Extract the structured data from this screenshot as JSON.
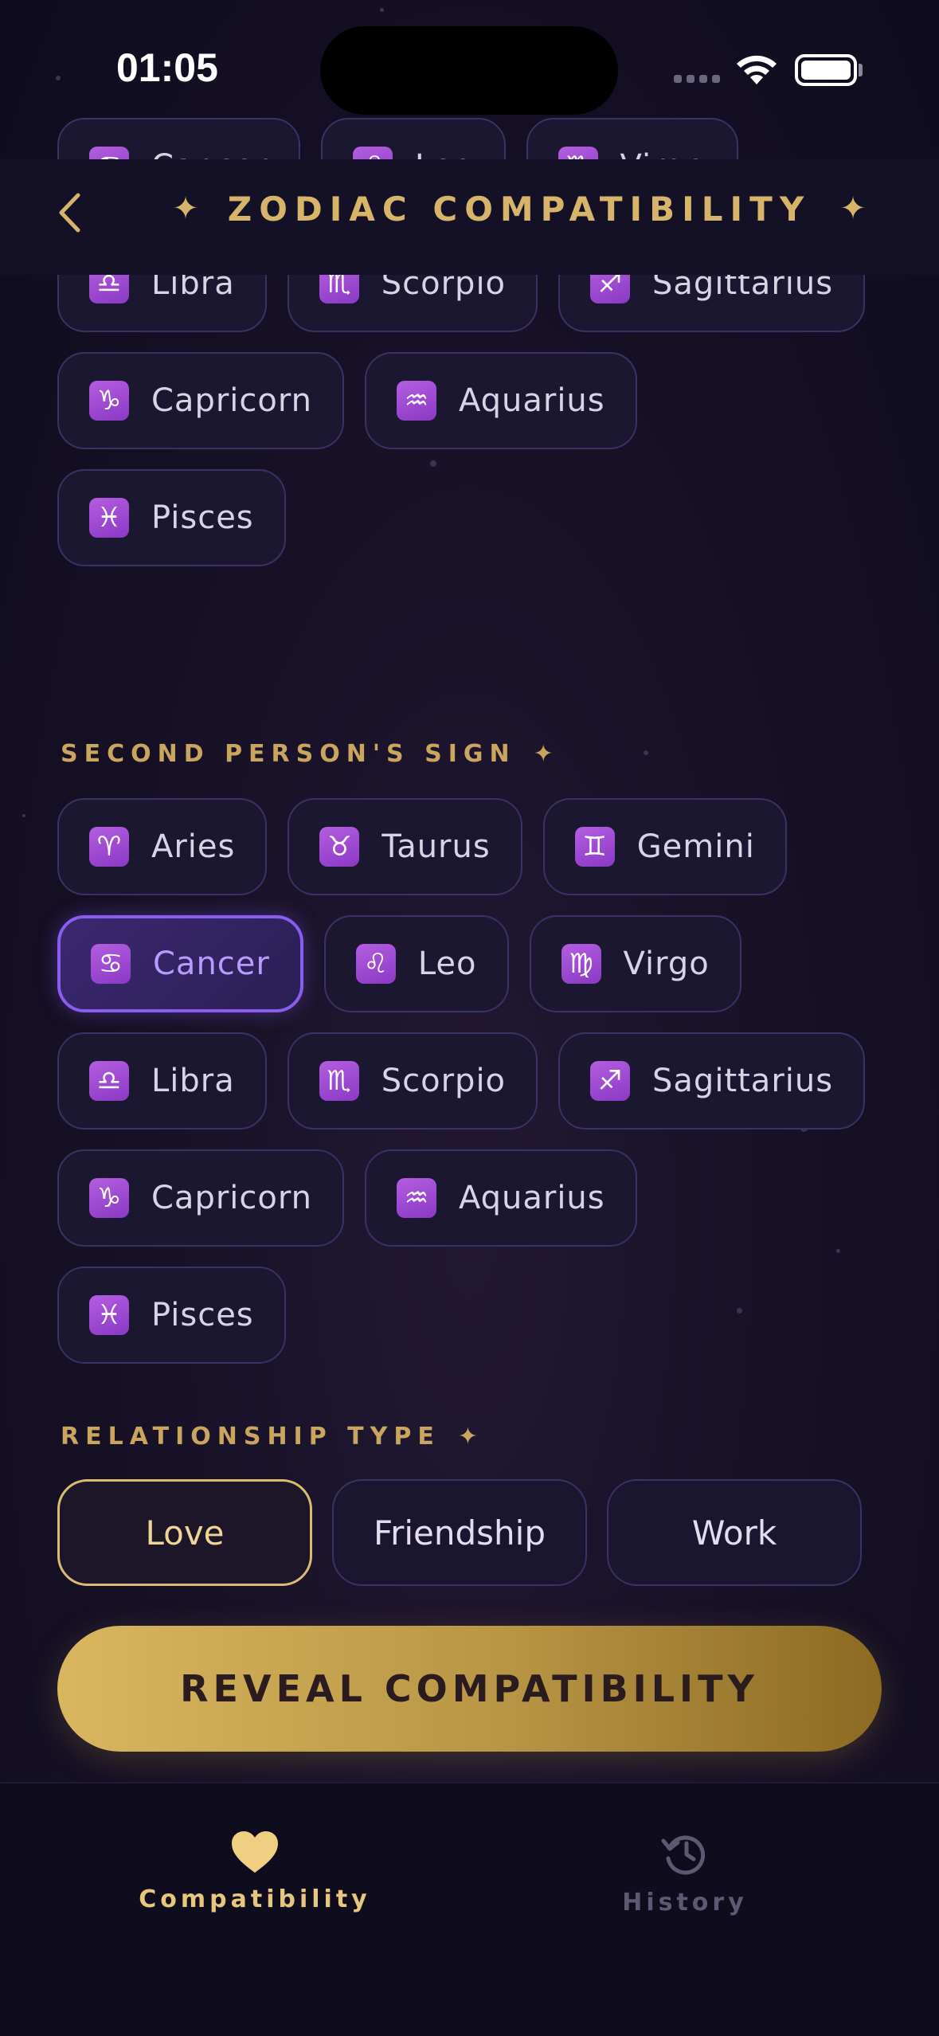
{
  "status_bar": {
    "time": "01:05"
  },
  "header": {
    "title": "ZODIAC COMPATIBILITY",
    "sparkle": "✦"
  },
  "first_sign_chips": [
    {
      "glyph": "♋",
      "label": "Cancer"
    },
    {
      "glyph": "♌",
      "label": "Leo"
    },
    {
      "glyph": "♍",
      "label": "Virgo"
    },
    {
      "glyph": "♎",
      "label": "Libra"
    },
    {
      "glyph": "♏",
      "label": "Scorpio"
    },
    {
      "glyph": "♐",
      "label": "Sagittarius"
    },
    {
      "glyph": "♑",
      "label": "Capricorn"
    },
    {
      "glyph": "♒",
      "label": "Aquarius"
    },
    {
      "glyph": "♓",
      "label": "Pisces"
    }
  ],
  "second_sign": {
    "label": "SECOND PERSON'S SIGN",
    "selected": "Cancer",
    "chips": [
      {
        "glyph": "♈",
        "label": "Aries"
      },
      {
        "glyph": "♉",
        "label": "Taurus"
      },
      {
        "glyph": "♊",
        "label": "Gemini"
      },
      {
        "glyph": "♋",
        "label": "Cancer"
      },
      {
        "glyph": "♌",
        "label": "Leo"
      },
      {
        "glyph": "♍",
        "label": "Virgo"
      },
      {
        "glyph": "♎",
        "label": "Libra"
      },
      {
        "glyph": "♏",
        "label": "Scorpio"
      },
      {
        "glyph": "♐",
        "label": "Sagittarius"
      },
      {
        "glyph": "♑",
        "label": "Capricorn"
      },
      {
        "glyph": "♒",
        "label": "Aquarius"
      },
      {
        "glyph": "♓",
        "label": "Pisces"
      }
    ]
  },
  "relationship": {
    "label": "RELATIONSHIP TYPE",
    "selected": "Love",
    "options": [
      "Love",
      "Friendship",
      "Work"
    ]
  },
  "cta": {
    "label": "REVEAL COMPATIBILITY"
  },
  "tabbar": {
    "tabs": [
      {
        "label": "Compatibility",
        "icon": "heart-icon",
        "active": true
      },
      {
        "label": "History",
        "icon": "history-icon",
        "active": false
      }
    ]
  },
  "colors": {
    "accent_gold": "#d6b46a",
    "selected_purple": "#8a5cf0",
    "chip_border": "#3a3164"
  }
}
